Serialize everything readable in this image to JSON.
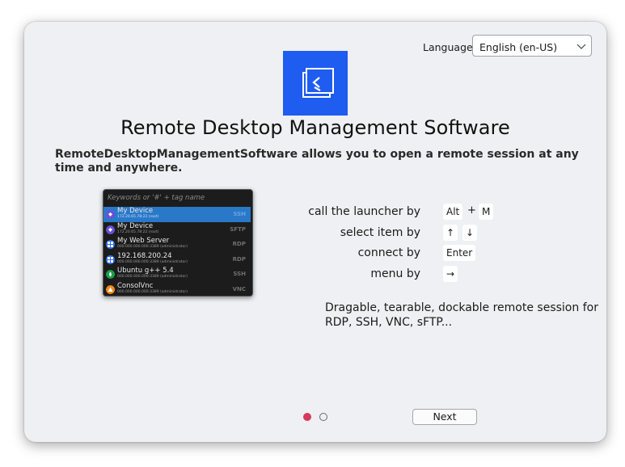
{
  "language": {
    "label": "Language:",
    "selected": "English (en-US)"
  },
  "app": {
    "title": "Remote Desktop Management Software",
    "description": "RemoteDesktopManagementSoftware allows you to open a remote session at any time and anywhere."
  },
  "launcher": {
    "search_placeholder": "Keywords or '#' + tag name",
    "items": [
      {
        "name": "My Device",
        "address": "172.20.65.78:22 (root)",
        "protocol": "SSH",
        "icon": "ssh-icon",
        "color": "#6b4fd8",
        "selected": true
      },
      {
        "name": "My Device",
        "address": "172.20.65.78:22 (root)",
        "protocol": "SFTP",
        "icon": "sftp-icon",
        "color": "#6b4fd8",
        "selected": false
      },
      {
        "name": "My Web Server",
        "address": "000.000.000.000:3389 (administrator)",
        "protocol": "RDP",
        "icon": "windows-icon",
        "color": "#2f6fe8",
        "selected": false
      },
      {
        "name": "192.168.200.24",
        "address": "000.000.000.000:3389 (administrator)",
        "protocol": "RDP",
        "icon": "windows-icon",
        "color": "#2f6fe8",
        "selected": false
      },
      {
        "name": "Ubuntu g++ 5.4",
        "address": "000.000.000.000:3389 (administrator)",
        "protocol": "SSH",
        "icon": "ubuntu-icon",
        "color": "#1aa04a",
        "selected": false
      },
      {
        "name": "ConsolVnc",
        "address": "000.000.000.000:3389 (administrator)",
        "protocol": "VNC",
        "icon": "vnc-icon",
        "color": "#f28a1c",
        "selected": false
      }
    ]
  },
  "shortcuts": [
    {
      "label": "call the launcher by",
      "keys": [
        "Alt",
        "M"
      ],
      "separator": "+"
    },
    {
      "label": "select item by",
      "keys": [
        "↑",
        "↓"
      ],
      "separator": ""
    },
    {
      "label": "connect by",
      "keys": [
        "Enter"
      ],
      "separator": ""
    },
    {
      "label": "menu by",
      "keys": [
        "→"
      ],
      "separator": ""
    }
  ],
  "feature_text": "Dragable, tearable, dockable remote session for RDP, SSH, VNC, sFTP...",
  "pagination": {
    "active_index": 0,
    "count": 2
  },
  "next_button": "Next",
  "colors": {
    "accent": "#1f5cf0",
    "active_dot": "#d63a5c",
    "selected_row": "#2a78c8"
  }
}
